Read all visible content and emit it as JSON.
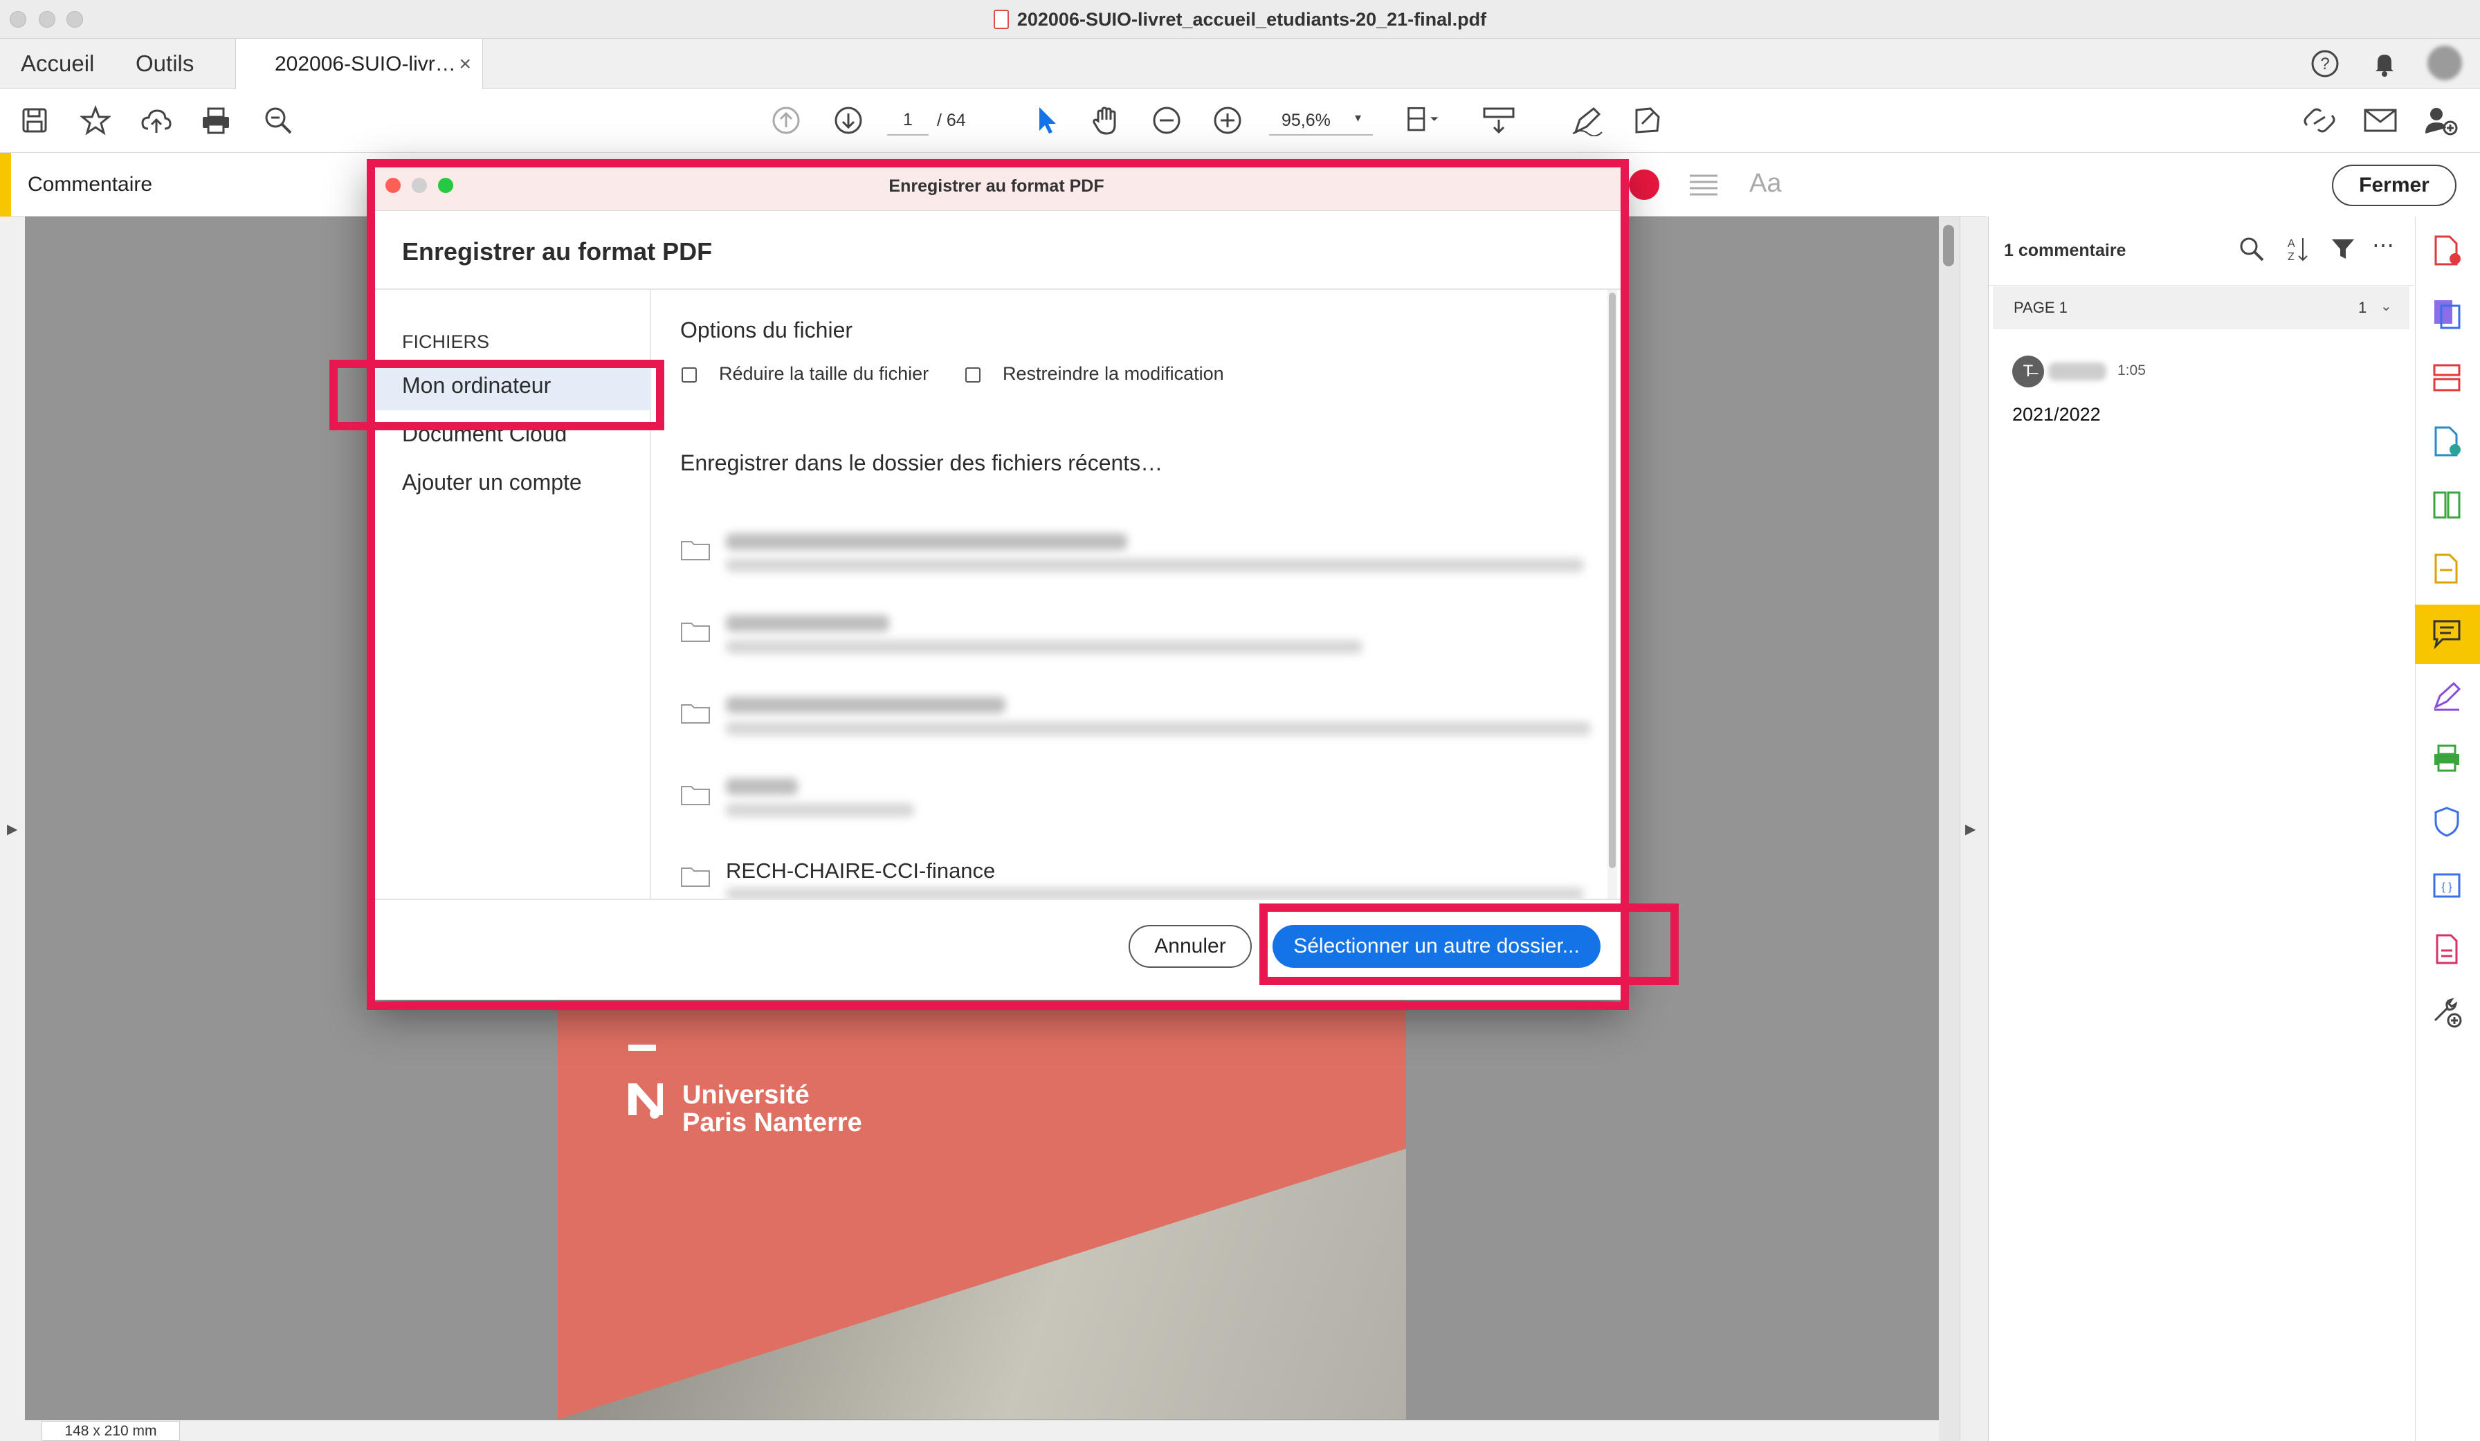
{
  "window": {
    "title": "202006-SUIO-livret_accueil_etudiants-20_21-final.pdf"
  },
  "nav": {
    "home": "Accueil",
    "tools": "Outils",
    "doc_tab": "202006-SUIO-livr…",
    "close_tab": "×"
  },
  "toolbar": {
    "page_current": "1",
    "page_total": "/ 64",
    "zoom": "95,6%"
  },
  "comment_bar": {
    "label": "Commentaire",
    "text_style": "Aa",
    "close": "Fermer"
  },
  "dialog": {
    "window_title": "Enregistrer au format PDF",
    "heading": "Enregistrer au format PDF",
    "sidebar": {
      "header": "FICHIERS",
      "items": [
        "Mon ordinateur",
        "Document Cloud",
        "Ajouter un compte"
      ]
    },
    "options": {
      "title": "Options du fichier",
      "reduce": "Réduire la taille du fichier",
      "restrict": "Restreindre la modification"
    },
    "recent_title": "Enregistrer dans le dossier des fichiers récents…",
    "recent_visible_name": "RECH-CHAIRE-CCI-finance",
    "cancel": "Annuler",
    "select_folder": "Sélectionner un autre dossier..."
  },
  "page_preview": {
    "line1": "Université",
    "line2": "Paris Nanterre"
  },
  "status": {
    "page_size": "148 x 210 mm"
  },
  "right_panel": {
    "count": "1 commentaire",
    "page_label": "PAGE 1",
    "page_count": "1",
    "comment_time": "1:05",
    "comment_text": "2021/2022"
  },
  "colors": {
    "highlight": "#e8174f",
    "accent_blue": "#1473e6",
    "comment_yellow": "#f7c600"
  }
}
